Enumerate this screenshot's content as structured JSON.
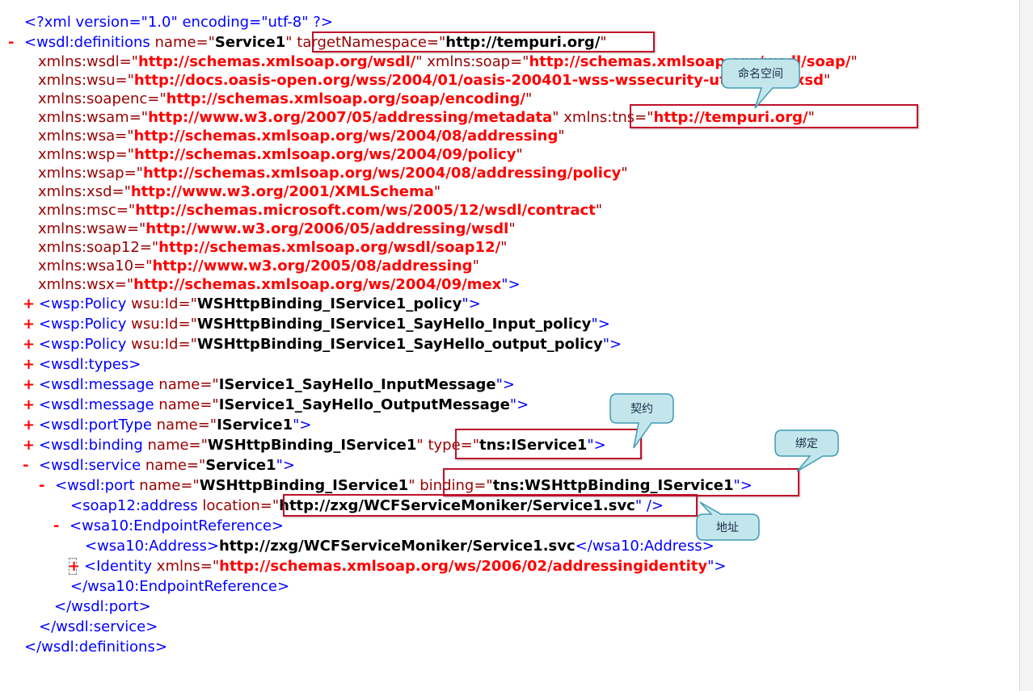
{
  "xml": {
    "decl": {
      "open": "<?xml version=\"1.0\" encoding=\"utf-8\" ?>"
    },
    "definitions": {
      "toggle": "-",
      "open_tag": "<wsdl:definitions",
      "attr_name": " name=\"",
      "name_val": "Service1",
      "attr_tns": "\" targetNamespace=\"",
      "tns_val": "http://tempuri.org/",
      "close_q": "\"",
      "ns": [
        {
          "a": "xmlns:wsdl=\"",
          "v": "http://schemas.xmlsoap.org/wsdl/",
          "a2": "\" xmlns:soap=\"",
          "v2": "http://schemas.xmlsoap.org/wsdl/soap/",
          "e": "\""
        },
        {
          "a": "xmlns:wsu=\"",
          "v": "http://docs.oasis-open.org/wss/2004/01/oasis-200401-wss-wssecurity-utility-1.0.xsd",
          "e": "\""
        },
        {
          "a": "xmlns:soapenc=\"",
          "v": "http://schemas.xmlsoap.org/soap/encoding/",
          "e": "\""
        },
        {
          "a": "xmlns:wsam=\"",
          "v": "http://www.w3.org/2007/05/addressing/metadata",
          "a2": "\" xmlns:tns=\"",
          "v2": "http://tempuri.org/",
          "e": "\""
        },
        {
          "a": "xmlns:wsa=\"",
          "v": "http://schemas.xmlsoap.org/ws/2004/08/addressing",
          "e": "\""
        },
        {
          "a": "xmlns:wsp=\"",
          "v": "http://schemas.xmlsoap.org/ws/2004/09/policy",
          "e": "\""
        },
        {
          "a": "xmlns:wsap=\"",
          "v": "http://schemas.xmlsoap.org/ws/2004/08/addressing/policy",
          "e": "\""
        },
        {
          "a": "xmlns:xsd=\"",
          "v": "http://www.w3.org/2001/XMLSchema",
          "e": "\""
        },
        {
          "a": "xmlns:msc=\"",
          "v": "http://schemas.microsoft.com/ws/2005/12/wsdl/contract",
          "e": "\""
        },
        {
          "a": "xmlns:wsaw=\"",
          "v": "http://www.w3.org/2006/05/addressing/wsdl",
          "e": "\""
        },
        {
          "a": "xmlns:soap12=\"",
          "v": "http://schemas.xmlsoap.org/wsdl/soap12/",
          "e": "\""
        },
        {
          "a": "xmlns:wsa10=\"",
          "v": "http://www.w3.org/2005/08/addressing",
          "e": "\""
        },
        {
          "a": "xmlns:wsx=\"",
          "v": "http://schemas.xmlsoap.org/ws/2004/09/mex",
          "e": "\">"
        }
      ],
      "close": "</wsdl:definitions>"
    },
    "children": [
      {
        "toggle": "+",
        "open": "<wsp:Policy",
        "attr": " wsu:Id=\"",
        "val": "WSHttpBinding_IService1_policy",
        "end": "\">"
      },
      {
        "toggle": "+",
        "open": "<wsp:Policy",
        "attr": " wsu:Id=\"",
        "val": "WSHttpBinding_IService1_SayHello_Input_policy",
        "end": "\">"
      },
      {
        "toggle": "+",
        "open": "<wsp:Policy",
        "attr": " wsu:Id=\"",
        "val": "WSHttpBinding_IService1_SayHello_output_policy",
        "end": "\">"
      },
      {
        "toggle": "+",
        "open": "<wsdl:types>"
      },
      {
        "toggle": "+",
        "open": "<wsdl:message",
        "attr": " name=\"",
        "val": "IService1_SayHello_InputMessage",
        "end": "\">"
      },
      {
        "toggle": "+",
        "open": "<wsdl:message",
        "attr": " name=\"",
        "val": "IService1_SayHello_OutputMessage",
        "end": "\">"
      },
      {
        "toggle": "+",
        "open": "<wsdl:portType",
        "attr": " name=\"",
        "val": "IService1",
        "end": "\">"
      }
    ],
    "binding": {
      "toggle": "+",
      "open": "<wsdl:binding",
      "attr": " name=\"",
      "val": "WSHttpBinding_IService1",
      "q": "\" ",
      "attr2": "type=\"",
      "val2": "tns:IService1",
      "end": "\">"
    },
    "service": {
      "toggle": "-",
      "open": "<wsdl:service",
      "attr": " name=\"",
      "val": "Service1",
      "end": "\">",
      "close": "</wsdl:service>",
      "port": {
        "toggle": "-",
        "open": "<wsdl:port",
        "attr": " name=\"",
        "val": "WSHttpBinding_IService1",
        "q": "\" ",
        "attr2": "binding=\"",
        "val2": "tns:WSHttpBinding_IService1",
        "end": "\">",
        "close": "</wsdl:port>",
        "address": {
          "open": "<soap12:address",
          "attr": " location=\"",
          "val": "http://zxg/WCFServiceMoniker/Service1.svc",
          "end": "\" />"
        },
        "epr": {
          "toggle": "-",
          "open": "<wsa10:EndpointReference>",
          "close": "</wsa10:EndpointReference>",
          "address_open": "<wsa10:Address>",
          "address_text": "http://zxg/WCFServiceMoniker/Service1.svc",
          "address_close": "</wsa10:Address>",
          "identity": {
            "toggle": "+",
            "open": "<Identity",
            "attr": " xmlns=\"",
            "val": "http://schemas.xmlsoap.org/ws/2006/02/addressingidentity",
            "end": "\">"
          }
        }
      }
    }
  },
  "callouts": {
    "namespace": "命名空间",
    "contract": "契约",
    "binding": "绑定",
    "address": "地址"
  },
  "colors": {
    "tag": "#0000ff",
    "attr_name": "#990000",
    "attr_value": "#000000",
    "ns_value": "#ff0000",
    "toggle": "#ff0000",
    "highlight_border": "#c0102a",
    "callout_fill": "#c3e6ec",
    "callout_border": "#3f9bb3"
  }
}
